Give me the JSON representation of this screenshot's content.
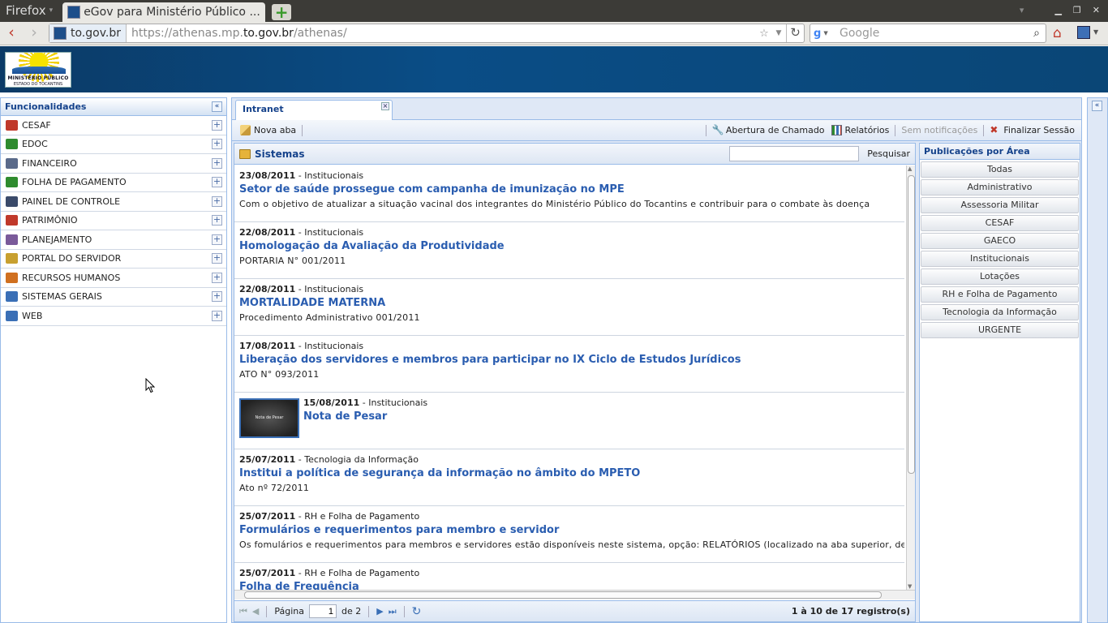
{
  "browser": {
    "app_menu": "Firefox",
    "tab_title": "eGov para Ministério Público ...",
    "site_identity": "to.gov.br",
    "url_prefix": "https://athenas.mp.",
    "url_domain": "to.gov.br",
    "url_suffix": "/athenas/",
    "search_placeholder": "Google",
    "search_engine": "g"
  },
  "logo": {
    "line1": "MINISTÉRIO PÚBLICO",
    "line2": "ESTADO DO TOCANTINS"
  },
  "sidebar": {
    "title": "Funcionalidades",
    "items": [
      {
        "label": "CESAF",
        "icon": "calendar-icon",
        "color": "#c0392b"
      },
      {
        "label": "EDOC",
        "icon": "at-sign-icon",
        "color": "#2e8b2e"
      },
      {
        "label": "FINANCEIRO",
        "icon": "chart-icon",
        "color": "#5a6a8a"
      },
      {
        "label": "FOLHA DE PAGAMENTO",
        "icon": "dollar-icon",
        "color": "#2e8b2e"
      },
      {
        "label": "PAINEL DE CONTROLE",
        "icon": "panel-icon",
        "color": "#3a4a6a"
      },
      {
        "label": "PATRIMÔNIO",
        "icon": "house-icon",
        "color": "#c0392b"
      },
      {
        "label": "PLANEJAMENTO",
        "icon": "graph-icon",
        "color": "#7a5a9a"
      },
      {
        "label": "PORTAL DO SERVIDOR",
        "icon": "portal-icon",
        "color": "#c8a030"
      },
      {
        "label": "RECURSOS HUMANOS",
        "icon": "people-icon",
        "color": "#d07020"
      },
      {
        "label": "SISTEMAS GERAIS",
        "icon": "grid-icon",
        "color": "#3a6fb6"
      },
      {
        "label": "WEB",
        "icon": "globe-icon",
        "color": "#3a6fb6"
      }
    ]
  },
  "main": {
    "tab": "Intranet",
    "toolbar": {
      "nova_aba": "Nova aba",
      "chamado": "Abertura de Chamado",
      "relatorios": "Relatórios",
      "notificacoes": "Sem notificações",
      "finalizar": "Finalizar Sessão"
    },
    "sistemas": {
      "title": "Sistemas",
      "search_button": "Pesquisar",
      "news": [
        {
          "date": "23/08/2011",
          "category": " - Institucionais",
          "title": "Setor de saúde prossegue com campanha de imunização no MPE",
          "desc": "Com o objetivo de atualizar a situação vacinal dos integrantes do Ministério Público do Tocantins e contribuir para o combate às doença"
        },
        {
          "date": "22/08/2011",
          "category": " - Institucionais",
          "title": "Homologação da Avaliação da Produtividade",
          "desc": "PORTARIA N° 001/2011"
        },
        {
          "date": "22/08/2011",
          "category": " - Institucionais",
          "title": "MORTALIDADE MATERNA",
          "desc": "Procedimento Administrativo 001/2011"
        },
        {
          "date": "17/08/2011",
          "category": " - Institucionais",
          "title": "Liberação dos servidores e membros para participar no IX Ciclo de Estudos Jurídicos",
          "desc": "ATO N° 093/2011"
        },
        {
          "date": "15/08/2011",
          "category": " - Institucionais",
          "title": "Nota de Pesar",
          "desc": "",
          "thumb": "Nota de Pesar"
        },
        {
          "date": "25/07/2011",
          "category": " - Tecnologia da Informação",
          "title": "Institui a política de segurança da informação no âmbito do MPETO",
          "desc": "Ato nº 72/2011"
        },
        {
          "date": "25/07/2011",
          "category": " - RH e Folha de Pagamento",
          "title": "Formulários e requerimentos para membro e servidor",
          "desc": "Os fomulários e requerimentos para membros e servidores estão disponíveis neste sistema, opção: RELATÓRIOS (localizado na aba superior, desta"
        },
        {
          "date": "25/07/2011",
          "category": " - RH e Folha de Pagamento",
          "title": "Folha de Frequência",
          "desc": ""
        }
      ],
      "pager": {
        "label": "Página",
        "page": "1",
        "of": "de 2",
        "info": "1 à 10 de 17 registro(s)"
      }
    },
    "publicacoes": {
      "title": "Publicações por Área",
      "buttons": [
        "Todas",
        "Administrativo",
        "Assessoria Militar",
        "CESAF",
        "GAECO",
        "Institucionais",
        "Lotações",
        "RH e Folha de Pagamento",
        "Tecnologia da Informação",
        "URGENTE"
      ]
    }
  }
}
